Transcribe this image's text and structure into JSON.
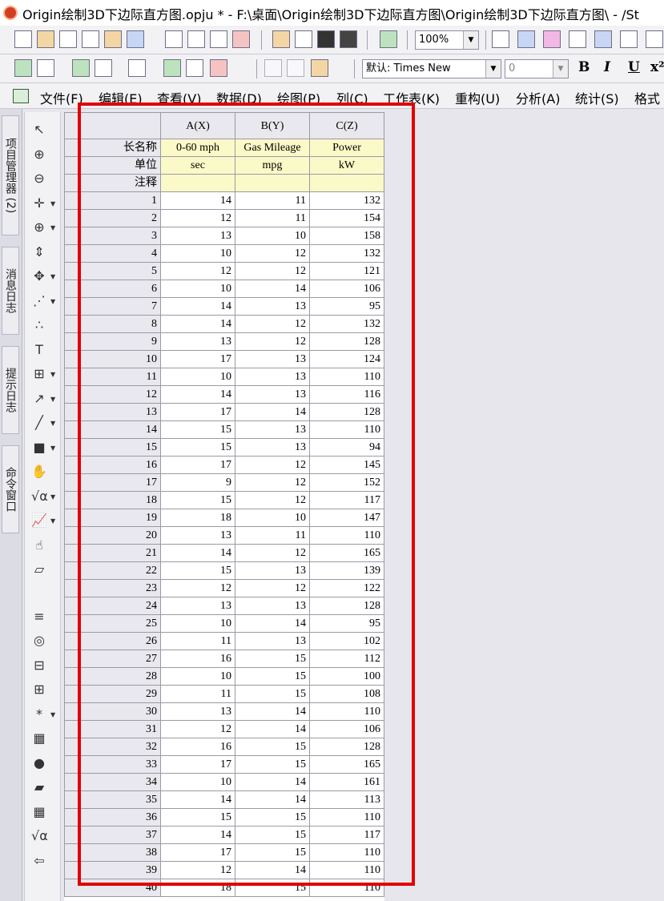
{
  "window": {
    "title": "Origin绘制3D下边际直方图.opju * - F:\\桌面\\Origin绘制3D下边际直方图\\Origin绘制3D下边际直方图\\ - /St"
  },
  "toolbar1": {
    "zoom": "100%"
  },
  "toolbar2": {
    "font": "默认: Times New",
    "size": "0",
    "bold": "B",
    "italic": "I",
    "underline": "U",
    "superscript": "x²"
  },
  "menu": [
    "文件(F)",
    "编辑(E)",
    "查看(V)",
    "数据(D)",
    "绘图(P)",
    "列(C)",
    "工作表(K)",
    "重构(U)",
    "分析(A)",
    "统计(S)",
    "格式"
  ],
  "dock_tabs": [
    "项目管理器 (2)",
    "消息日志",
    "提示日志",
    "命令窗口"
  ],
  "tools": [
    {
      "icon": "pointer-icon",
      "glyph": "↖"
    },
    {
      "icon": "zoom-in-icon",
      "glyph": "⊕"
    },
    {
      "icon": "zoom-out-icon",
      "glyph": "⊖"
    },
    {
      "icon": "screen-reader-icon",
      "glyph": "✛"
    },
    {
      "icon": "data-reader-icon",
      "glyph": "⊕"
    },
    {
      "icon": "data-slider-icon",
      "glyph": "⇕"
    },
    {
      "icon": "region-mask-icon",
      "glyph": "✥"
    },
    {
      "icon": "draw-data-icon",
      "glyph": "⋰"
    },
    {
      "icon": "scatter-points-icon",
      "glyph": "∴"
    },
    {
      "icon": "text-tool-icon",
      "glyph": "T"
    },
    {
      "icon": "table-tool-icon",
      "glyph": "⊞"
    },
    {
      "icon": "arrow-tool-icon",
      "glyph": "↗"
    },
    {
      "icon": "line-tool-icon",
      "glyph": "╱"
    },
    {
      "icon": "rectangle-tool-icon",
      "glyph": "■"
    },
    {
      "icon": "hand-tool-icon",
      "glyph": "✋"
    },
    {
      "icon": "equation-tool-icon",
      "glyph": "√α"
    },
    {
      "icon": "graph-insert-icon",
      "glyph": "📈"
    },
    {
      "icon": "layer-hand-icon",
      "glyph": "☝"
    },
    {
      "icon": "object-icon",
      "glyph": "▱"
    },
    {
      "icon": "column-list-icon",
      "glyph": "≡"
    },
    {
      "icon": "circle-tool-icon",
      "glyph": "◎"
    },
    {
      "icon": "align-tool-icon",
      "glyph": "⊟"
    },
    {
      "icon": "formula-table-icon",
      "glyph": "⊞"
    },
    {
      "icon": "marker-icon",
      "glyph": "*"
    },
    {
      "icon": "calculator-icon",
      "glyph": "▦"
    },
    {
      "icon": "mark-red-icon",
      "glyph": "●"
    },
    {
      "icon": "folder-icon",
      "glyph": "▰"
    },
    {
      "icon": "grid-icon",
      "glyph": "▦"
    },
    {
      "icon": "sqrt-icon",
      "glyph": "√α"
    },
    {
      "icon": "back-arrow-icon",
      "glyph": "⇦"
    }
  ],
  "sheet": {
    "columns": [
      "A(X)",
      "B(Y)",
      "C(Z)"
    ],
    "label_rows": [
      {
        "name": "长名称",
        "values": [
          "0-60 mph",
          "Gas Mileage",
          "Power"
        ]
      },
      {
        "name": "单位",
        "values": [
          "sec",
          "mpg",
          "kW"
        ]
      },
      {
        "name": "注释",
        "values": [
          "",
          "",
          ""
        ]
      }
    ],
    "rows": [
      [
        1,
        14,
        11,
        132
      ],
      [
        2,
        12,
        11,
        154
      ],
      [
        3,
        13,
        10,
        158
      ],
      [
        4,
        10,
        12,
        132
      ],
      [
        5,
        12,
        12,
        121
      ],
      [
        6,
        10,
        14,
        106
      ],
      [
        7,
        14,
        13,
        95
      ],
      [
        8,
        14,
        12,
        132
      ],
      [
        9,
        13,
        12,
        128
      ],
      [
        10,
        17,
        13,
        124
      ],
      [
        11,
        10,
        13,
        110
      ],
      [
        12,
        14,
        13,
        116
      ],
      [
        13,
        17,
        14,
        128
      ],
      [
        14,
        15,
        13,
        110
      ],
      [
        15,
        15,
        13,
        94
      ],
      [
        16,
        17,
        12,
        145
      ],
      [
        17,
        9,
        12,
        152
      ],
      [
        18,
        15,
        12,
        117
      ],
      [
        19,
        18,
        10,
        147
      ],
      [
        20,
        13,
        11,
        110
      ],
      [
        21,
        14,
        12,
        165
      ],
      [
        22,
        15,
        13,
        139
      ],
      [
        23,
        12,
        12,
        122
      ],
      [
        24,
        13,
        13,
        128
      ],
      [
        25,
        10,
        14,
        95
      ],
      [
        26,
        11,
        13,
        102
      ],
      [
        27,
        16,
        15,
        112
      ],
      [
        28,
        10,
        15,
        100
      ],
      [
        29,
        11,
        15,
        108
      ],
      [
        30,
        13,
        14,
        110
      ],
      [
        31,
        12,
        14,
        106
      ],
      [
        32,
        16,
        15,
        128
      ],
      [
        33,
        17,
        15,
        165
      ],
      [
        34,
        10,
        14,
        161
      ],
      [
        35,
        14,
        14,
        113
      ],
      [
        36,
        15,
        15,
        110
      ],
      [
        37,
        14,
        15,
        117
      ],
      [
        38,
        17,
        15,
        110
      ],
      [
        39,
        12,
        14,
        110
      ],
      [
        40,
        18,
        15,
        110
      ]
    ]
  }
}
